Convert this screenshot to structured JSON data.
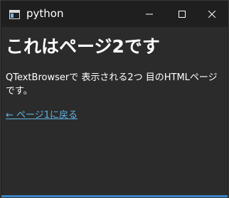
{
  "window": {
    "title": "python",
    "icon": "window-icon",
    "controls": [
      "minimize-icon",
      "maximize-icon",
      "close-icon"
    ]
  },
  "content": {
    "heading": "これはページ2です",
    "paragraph": "QTextBrowserで 表示される2つ 目のHTMLページです。",
    "link": "← ページ1に戻る"
  },
  "colors": {
    "background": "#2b2b2b",
    "titlebar": "#1f1f1f",
    "text": "#ffffff",
    "link": "#5fb3e8",
    "accent": "#3a85c8"
  }
}
